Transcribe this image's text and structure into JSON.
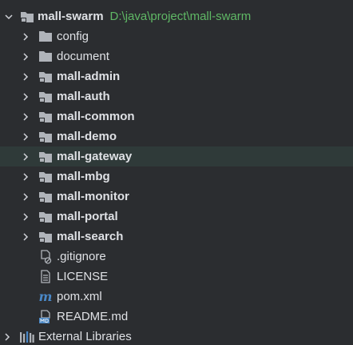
{
  "tree": {
    "root": {
      "label": "mall-swarm",
      "path": "D:\\java\\project\\mall-swarm"
    },
    "items": [
      {
        "label": "config",
        "type": "folder"
      },
      {
        "label": "document",
        "type": "folder"
      },
      {
        "label": "mall-admin",
        "type": "module"
      },
      {
        "label": "mall-auth",
        "type": "module"
      },
      {
        "label": "mall-common",
        "type": "module"
      },
      {
        "label": "mall-demo",
        "type": "module"
      },
      {
        "label": "mall-gateway",
        "type": "module",
        "selected": true
      },
      {
        "label": "mall-mbg",
        "type": "module"
      },
      {
        "label": "mall-monitor",
        "type": "module"
      },
      {
        "label": "mall-portal",
        "type": "module"
      },
      {
        "label": "mall-search",
        "type": "module"
      }
    ],
    "files": [
      {
        "label": ".gitignore",
        "icon": "gitignore-file-icon"
      },
      {
        "label": "LICENSE",
        "icon": "text-file-icon"
      },
      {
        "label": "pom.xml",
        "icon": "maven-file-icon"
      },
      {
        "label": "README.md",
        "icon": "markdown-file-icon"
      }
    ],
    "external": {
      "label": "External Libraries"
    }
  },
  "colors": {
    "background": "#2b2d30",
    "selected_row": "#2f3a39",
    "text": "#dfe1e5",
    "path": "#5fb865",
    "folder_icon": "#b0b4ba",
    "maven_icon": "#4a88c7"
  }
}
